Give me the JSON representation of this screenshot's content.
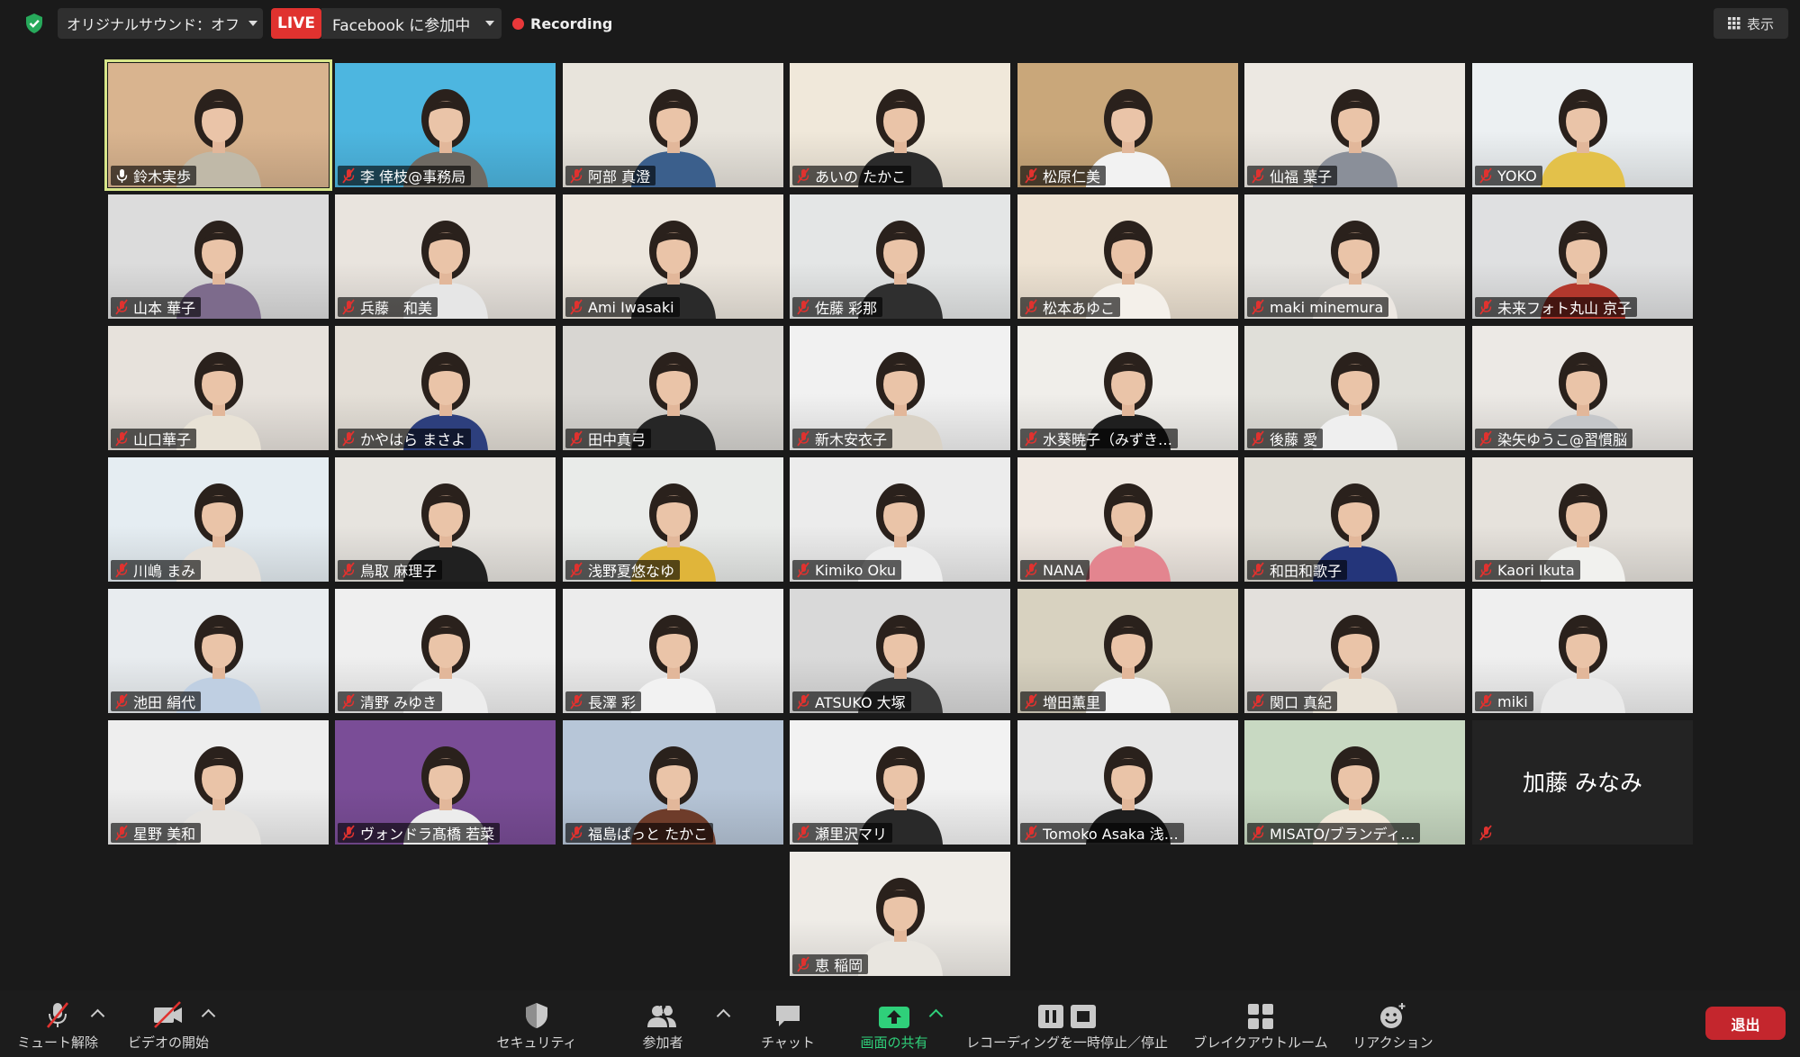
{
  "topbar": {
    "original_sound": "オリジナルサウンド：オフ",
    "live_badge": "LIVE",
    "live_destination": "Facebook に参加中",
    "recording": "Recording",
    "view_button": "表示"
  },
  "participants": [
    {
      "name": "鈴木実歩",
      "bg": "#d9b48f",
      "shirt": "#c0b9a8",
      "active": true,
      "muted": false
    },
    {
      "name": "李 倖枝@事務局",
      "bg": "#4db6e0",
      "shirt": "#6f6a63",
      "muted": true
    },
    {
      "name": "阿部 真澄",
      "bg": "#e8e4dc",
      "shirt": "#3b5f8c",
      "muted": true
    },
    {
      "name": "あいの たかこ",
      "bg": "#f0e8da",
      "shirt": "#2b2b2b",
      "muted": true
    },
    {
      "name": "松原仁美",
      "bg": "#c9a77a",
      "shirt": "#f2f2f2",
      "muted": true
    },
    {
      "name": "仙福 葉子",
      "bg": "#ece8e2",
      "shirt": "#8a8f99",
      "muted": true
    },
    {
      "name": "YOKO",
      "bg": "#ecf0f2",
      "shirt": "#e3c14a",
      "muted": true
    },
    {
      "name": "山本 華子",
      "bg": "#dcdcdc",
      "shirt": "#7d6b8c",
      "muted": true
    },
    {
      "name": "兵藤　和美",
      "bg": "#e9e4de",
      "shirt": "#e6e6e6",
      "muted": true
    },
    {
      "name": "Ami Iwasaki",
      "bg": "#ece6dd",
      "shirt": "#2a2a2a",
      "muted": true
    },
    {
      "name": "佐藤 彩那",
      "bg": "#e4e6e6",
      "shirt": "#2f2f2f",
      "muted": true
    },
    {
      "name": "松本あゆこ",
      "bg": "#eee3d3",
      "shirt": "#f4f0ea",
      "muted": true
    },
    {
      "name": "maki minemura",
      "bg": "#e6e4e0",
      "shirt": "#ece7e2",
      "muted": true
    },
    {
      "name": "未来フォト丸山 京子",
      "bg": "#dfe0e1",
      "shirt": "#b3382d",
      "muted": true
    },
    {
      "name": "山口華子",
      "bg": "#e7e2dc",
      "shirt": "#e8e2d6",
      "muted": true
    },
    {
      "name": "かやはら まさよ",
      "bg": "#e4dfd7",
      "shirt": "#2d3f7d",
      "muted": true
    },
    {
      "name": "田中真弓",
      "bg": "#d8d6d2",
      "shirt": "#262626",
      "muted": true
    },
    {
      "name": "新木安衣子",
      "bg": "#f1f1f1",
      "shirt": "#d9d2c6",
      "muted": true
    },
    {
      "name": "水葵暁子（みずき…",
      "bg": "#f0eeea",
      "shirt": "#1f1f1f",
      "muted": true
    },
    {
      "name": "後藤 愛",
      "bg": "#e0dfd9",
      "shirt": "#efefef",
      "muted": true
    },
    {
      "name": "染矢ゆうこ@習慣脳",
      "bg": "#ece9e5",
      "shirt": "#c5c7ca",
      "muted": true
    },
    {
      "name": "川嶋 まみ",
      "bg": "#e5edf2",
      "shirt": "#e6e1da",
      "muted": true
    },
    {
      "name": "鳥取 麻理子",
      "bg": "#e7e4df",
      "shirt": "#202020",
      "muted": true
    },
    {
      "name": "浅野夏悠なゆ",
      "bg": "#e9ebe9",
      "shirt": "#e0b53a",
      "muted": true
    },
    {
      "name": "Kimiko Oku",
      "bg": "#ececec",
      "shirt": "#eeeeee",
      "muted": true
    },
    {
      "name": "NANA",
      "bg": "#f0e9e2",
      "shirt": "#e3858f",
      "muted": true
    },
    {
      "name": "和田和歌子",
      "bg": "#dedbd3",
      "shirt": "#24357a",
      "muted": true
    },
    {
      "name": "Kaori Ikuta",
      "bg": "#e6e2dc",
      "shirt": "#f1f1ee",
      "muted": true
    },
    {
      "name": "池田 絹代",
      "bg": "#e8ecef",
      "shirt": "#bfcfe2",
      "muted": true
    },
    {
      "name": "清野 みゆき",
      "bg": "#efefef",
      "shirt": "#ededed",
      "muted": true
    },
    {
      "name": "長澤 彩",
      "bg": "#ececec",
      "shirt": "#f2f2f2",
      "muted": true
    },
    {
      "name": "ATSUKO 大塚",
      "bg": "#d9d9d9",
      "shirt": "#3a3a3a",
      "muted": true
    },
    {
      "name": "増田薫里",
      "bg": "#d8d2c0",
      "shirt": "#f2f2f2",
      "muted": true
    },
    {
      "name": "関口 真紀",
      "bg": "#e3e0dc",
      "shirt": "#e9e3d8",
      "muted": true
    },
    {
      "name": "miki",
      "bg": "#efefef",
      "shirt": "#eaeaea",
      "muted": true
    },
    {
      "name": "星野 美和",
      "bg": "#eeeeee",
      "shirt": "#e5e3e0",
      "muted": true
    },
    {
      "name": "ヴォンドラ髙橋 若菜",
      "bg": "#7a4d97",
      "shirt": "#ececec",
      "muted": true
    },
    {
      "name": "福島ぱっと たかこ",
      "bg": "#b7c6d8",
      "shirt": "#6e3c2a",
      "muted": true
    },
    {
      "name": "瀬里沢マリ",
      "bg": "#f2f2f2",
      "shirt": "#292929",
      "muted": true
    },
    {
      "name": "Tomoko Asaka 浅…",
      "bg": "#e6e6e6",
      "shirt": "#1e1e1e",
      "muted": true
    },
    {
      "name": "MISATO/ブランディ…",
      "bg": "#c8d9c2",
      "shirt": "#f1e8d9",
      "muted": true
    },
    {
      "name": "加藤 みなみ",
      "camera_off": true,
      "muted": true
    },
    {
      "name": "恵 稲岡",
      "bg": "#efece7",
      "shirt": "#e9e6e0",
      "muted": true
    }
  ],
  "bottombar": {
    "unmute": "ミュート解除",
    "start_video": "ビデオの開始",
    "security": "セキュリティ",
    "participants": "参加者",
    "participant_count": "43",
    "chat": "チャット",
    "share_screen": "画面の共有",
    "recording_control": "レコーディングを一時停止／停止",
    "breakout": "ブレイクアウトルーム",
    "reactions": "リアクション",
    "leave": "退出"
  },
  "colors": {
    "background": "#1a1a1a",
    "live": "#e0322f",
    "recording_dot": "#e8383a",
    "muted_icon": "#e0322f",
    "active_speaker": "#d7e58a",
    "share_green": "#2fd07a",
    "leave": "#c4262d"
  }
}
